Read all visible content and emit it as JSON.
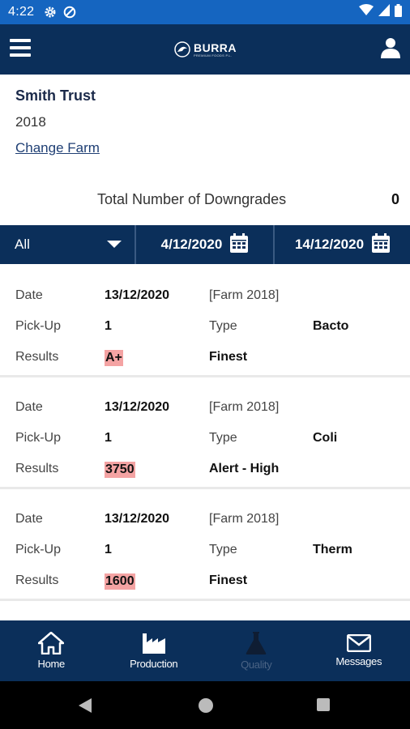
{
  "status_bar": {
    "time": "4:22",
    "left_icons": [
      "gear-icon",
      "data-saver-icon"
    ],
    "right_icons": [
      "wifi-icon",
      "cellular-signal-icon",
      "battery-icon"
    ],
    "color": "#1565c0"
  },
  "app_bar": {
    "logo_text": "BURRA",
    "logo_subtext": "PREMIUM FOODS P.L.",
    "menu_icon": "hamburger-menu-icon",
    "user_icon": "user-icon",
    "color": "#0b2f5a"
  },
  "farm": {
    "name": "Smith Trust",
    "number": "2018",
    "change_link": "Change Farm"
  },
  "summary": {
    "label": "Total Number of Downgrades",
    "value": "0"
  },
  "filter": {
    "selected": "All",
    "start_date": "4/12/2020",
    "end_date": "14/12/2020"
  },
  "records": [
    {
      "date_label": "Date",
      "date": "13/12/2020",
      "farm": "[Farm 2018]",
      "pickup_label": "Pick-Up",
      "pickup": "1",
      "type_label": "Type",
      "type": "Bacto",
      "results_label": "Results",
      "result": "A+",
      "grade": "Finest"
    },
    {
      "date_label": "Date",
      "date": "13/12/2020",
      "farm": "[Farm 2018]",
      "pickup_label": "Pick-Up",
      "pickup": "1",
      "type_label": "Type",
      "type": "Coli",
      "results_label": "Results",
      "result": "3750",
      "grade": "Alert - High"
    },
    {
      "date_label": "Date",
      "date": "13/12/2020",
      "farm": "[Farm 2018]",
      "pickup_label": "Pick-Up",
      "pickup": "1",
      "type_label": "Type",
      "type": "Therm",
      "results_label": "Results",
      "result": "1600",
      "grade": "Finest"
    }
  ],
  "result_highlight_color": "#f4a3a3",
  "bottom_nav": {
    "items": [
      {
        "label": "Home",
        "icon": "home-icon"
      },
      {
        "label": "Production",
        "icon": "factory-icon"
      },
      {
        "label": "Quality",
        "icon": "flask-icon",
        "active": true
      },
      {
        "label": "Messages",
        "icon": "envelope-icon"
      }
    ]
  },
  "system_nav": [
    "back-icon",
    "home-circle-icon",
    "recents-icon"
  ]
}
